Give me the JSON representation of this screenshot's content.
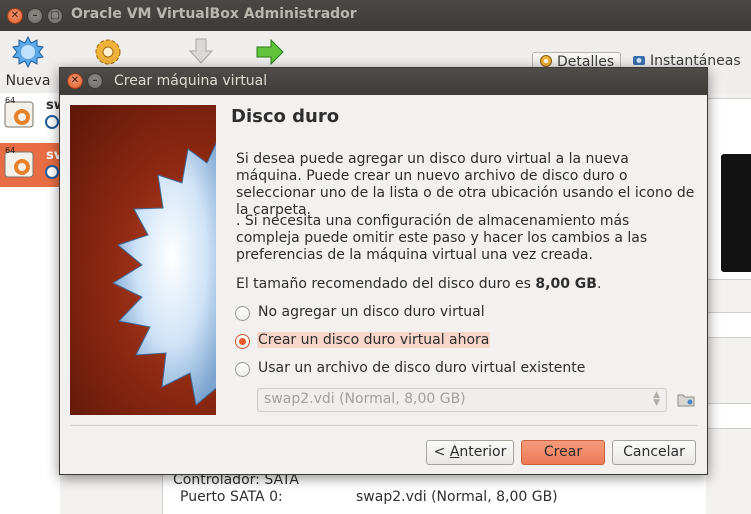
{
  "main_window": {
    "title": "Oracle VM VirtualBox Administrador",
    "toolbar": {
      "new_label": "Nueva",
      "details_label": "Detalles",
      "snapshots_label": "Instantáneas"
    },
    "vm_list": [
      {
        "badge": "64",
        "name_fragment": "sw",
        "selected": false
      },
      {
        "badge": "64",
        "name_fragment": "sv",
        "selected": true
      }
    ],
    "details": {
      "controller_label": "Controlador: SATA",
      "port_label": "Puerto SATA 0:",
      "port_value": "swap2.vdi (Normal, 8,00 GB)"
    }
  },
  "dialog": {
    "title": "Crear máquina virtual",
    "heading": "Disco duro",
    "paragraph1": "Si desea puede agregar un disco duro virtual a la nueva máquina. Puede crear un nuevo archivo de disco duro o seleccionar uno de la lista o de otra ubicación usando el icono de la carpeta.",
    "paragraph2": ". Si necesita una configuración de almacenamiento más compleja puede omitir este paso y hacer los cambios a las preferencias de la máquina virtual una vez creada.",
    "recommended_prefix": "El tamaño recomendado del disco duro es ",
    "recommended_size": "8,00 GB",
    "recommended_suffix": ".",
    "options": [
      {
        "label": "No agregar un disco duro virtual",
        "checked": false
      },
      {
        "label": "Crear un disco duro virtual ahora",
        "checked": true
      },
      {
        "label": "Usar un archivo de disco duro virtual existente",
        "checked": false
      }
    ],
    "existing_disk_value": "swap2.vdi (Normal, 8,00 GB)",
    "buttons": {
      "back_lt": "< ",
      "back_accel": "A",
      "back_rest": "nterior",
      "create": "Crear",
      "cancel": "Cancelar"
    },
    "colors": {
      "accent": "#e9572a",
      "primary_button": "#ec7a56",
      "selected_vm": "#e96d44"
    }
  },
  "icons": [
    "close-icon",
    "minimize-icon",
    "maximize-icon",
    "new-vm-icon",
    "settings-gear-icon",
    "discard-arrow-icon",
    "start-arrow-icon",
    "details-gear-icon",
    "snapshots-camera-icon",
    "vm-os-icon",
    "vm-state-icon",
    "folder-icon",
    "wizard-watermark-icon"
  ]
}
